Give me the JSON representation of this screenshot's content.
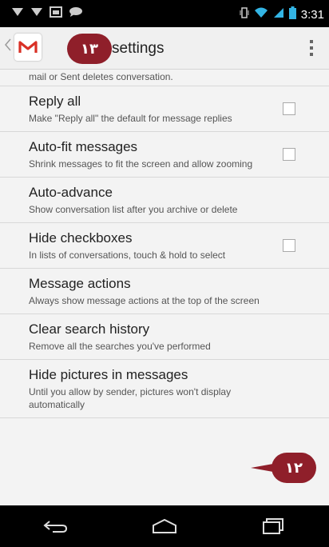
{
  "status_bar": {
    "time": "3:31",
    "left_icons": [
      "twitter-icon",
      "twitter-icon",
      "image-icon",
      "chat-icon"
    ],
    "right_icons": [
      "vibrate-icon",
      "wifi-icon",
      "signal-icon",
      "battery-icon"
    ]
  },
  "action_bar": {
    "title": "Gmail settings",
    "title_visible": "settings",
    "logo_icon": "gmail-m-icon",
    "menu_icon": "overflow-menu-icon"
  },
  "annotations": {
    "badge_top": "۱۳",
    "badge_bottom": "۱۲"
  },
  "partial_item": "mail or Sent deletes conversation.",
  "settings": [
    {
      "title": "Reply all",
      "summary": "Make \"Reply all\" the default for message replies",
      "has_checkbox": true,
      "checked": false
    },
    {
      "title": "Auto-fit messages",
      "summary": "Shrink messages to fit the screen and allow zooming",
      "has_checkbox": true,
      "checked": false
    },
    {
      "title": "Auto-advance",
      "summary": "Show conversation list after you archive or delete",
      "has_checkbox": false
    },
    {
      "title": "Hide checkboxes",
      "summary": "In lists of conversations, touch & hold to select",
      "has_checkbox": true,
      "checked": false
    },
    {
      "title": "Message actions",
      "summary": "Always show message actions at the top of the screen",
      "has_checkbox": false
    },
    {
      "title": "Clear search history",
      "summary": "Remove all the searches you've performed",
      "has_checkbox": false
    },
    {
      "title": "Hide pictures in messages",
      "summary": "Until you allow by sender, pictures won't display automatically",
      "has_checkbox": false
    }
  ],
  "nav_bar": {
    "buttons": [
      "back-icon",
      "home-icon",
      "recents-icon"
    ]
  },
  "colors": {
    "badge": "#8f1f2a",
    "status_bar": "#000000",
    "background": "#f3f3f3"
  }
}
